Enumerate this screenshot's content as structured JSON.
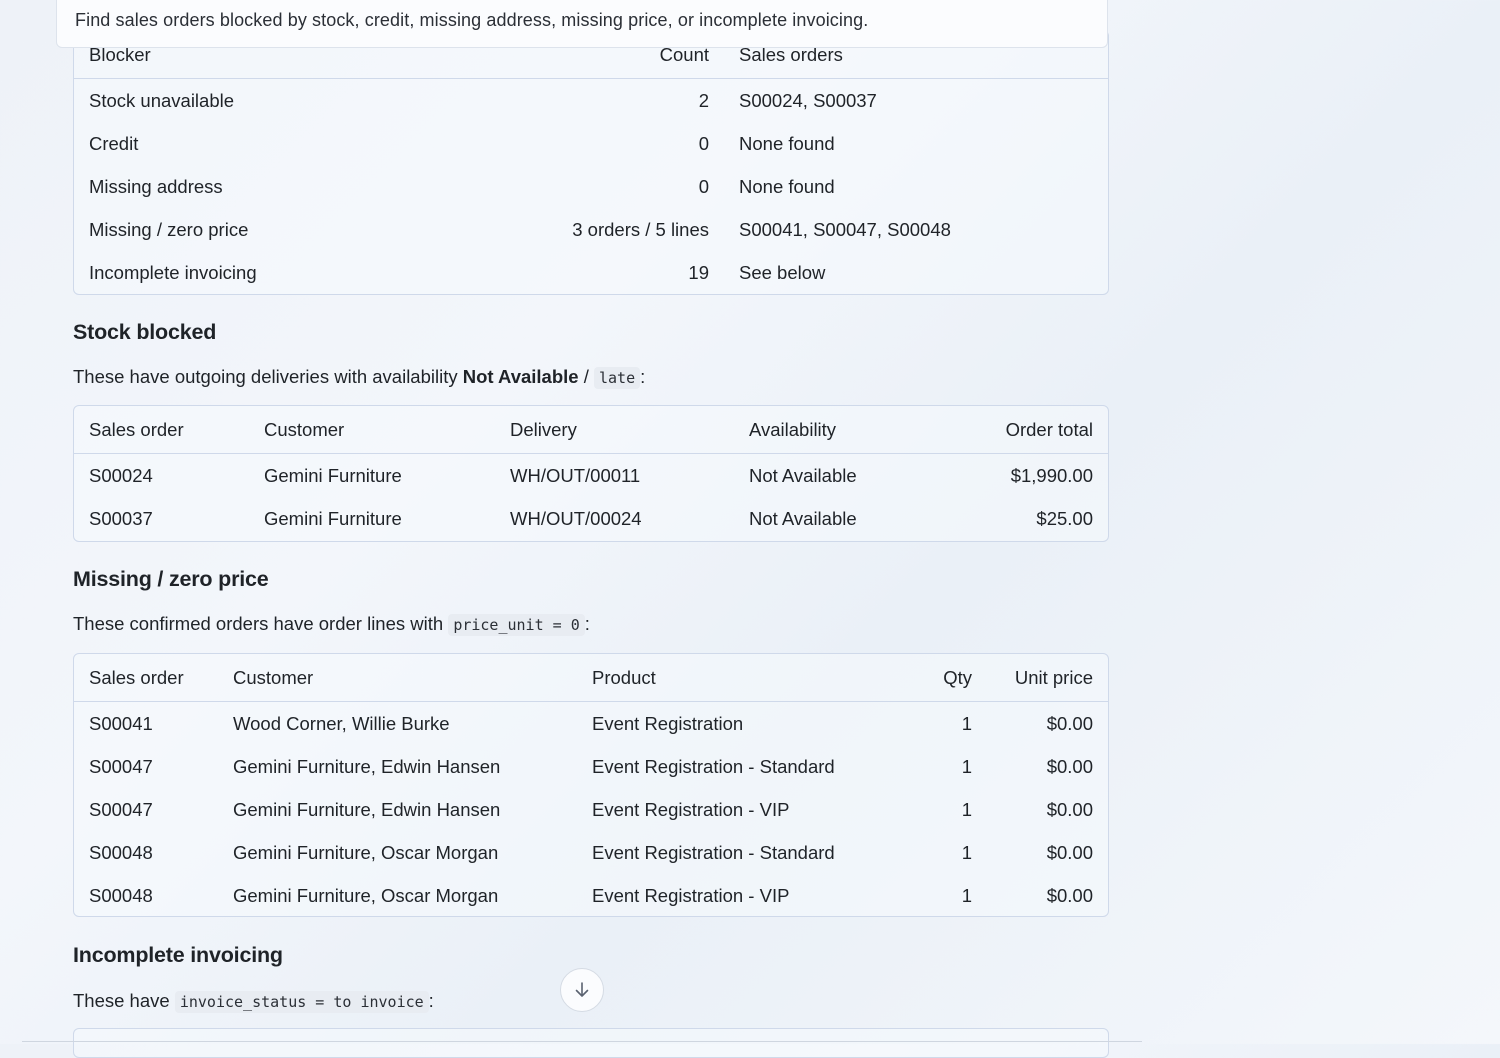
{
  "query": "Find sales orders blocked by stock, credit, missing address, missing price, or incomplete invoicing.",
  "summary": {
    "headers": [
      "Blocker",
      "Count",
      "Sales orders"
    ],
    "rows": [
      [
        "Stock unavailable",
        "2",
        "S00024, S00037"
      ],
      [
        "Credit",
        "0",
        "None found"
      ],
      [
        "Missing address",
        "0",
        "None found"
      ],
      [
        "Missing / zero price",
        "3 orders / 5 lines",
        "S00041, S00047, S00048"
      ],
      [
        "Incomplete invoicing",
        "19",
        "See below"
      ]
    ]
  },
  "stock": {
    "title": "Stock blocked",
    "intro": "These have outgoing deliveries with availability ",
    "intro_bold": "Not Available",
    "intro_sep": " / ",
    "intro_code": "late",
    "intro_end": ":",
    "headers": [
      "Sales order",
      "Customer",
      "Delivery",
      "Availability",
      "Order total"
    ],
    "rows": [
      [
        "S00024",
        "Gemini Furniture",
        "WH/OUT/00011",
        "Not Available",
        "$1,990.00"
      ],
      [
        "S00037",
        "Gemini Furniture",
        "WH/OUT/00024",
        "Not Available",
        "$25.00"
      ]
    ]
  },
  "price": {
    "title": "Missing / zero price",
    "intro": "These confirmed orders have order lines with ",
    "intro_code": "price_unit = 0",
    "intro_end": ":",
    "headers": [
      "Sales order",
      "Customer",
      "Product",
      "Qty",
      "Unit price"
    ],
    "rows": [
      [
        "S00041",
        "Wood Corner, Willie Burke",
        "Event Registration",
        "1",
        "$0.00"
      ],
      [
        "S00047",
        "Gemini Furniture, Edwin Hansen",
        "Event Registration - Standard",
        "1",
        "$0.00"
      ],
      [
        "S00047",
        "Gemini Furniture, Edwin Hansen",
        "Event Registration - VIP",
        "1",
        "$0.00"
      ],
      [
        "S00048",
        "Gemini Furniture, Oscar Morgan",
        "Event Registration - Standard",
        "1",
        "$0.00"
      ],
      [
        "S00048",
        "Gemini Furniture, Oscar Morgan",
        "Event Registration - VIP",
        "1",
        "$0.00"
      ]
    ]
  },
  "invoicing": {
    "title": "Incomplete invoicing",
    "intro": "These have ",
    "intro_code": "invoice_status = to invoice",
    "intro_end": ":"
  },
  "icons": {
    "scroll": "arrow-down-icon"
  }
}
